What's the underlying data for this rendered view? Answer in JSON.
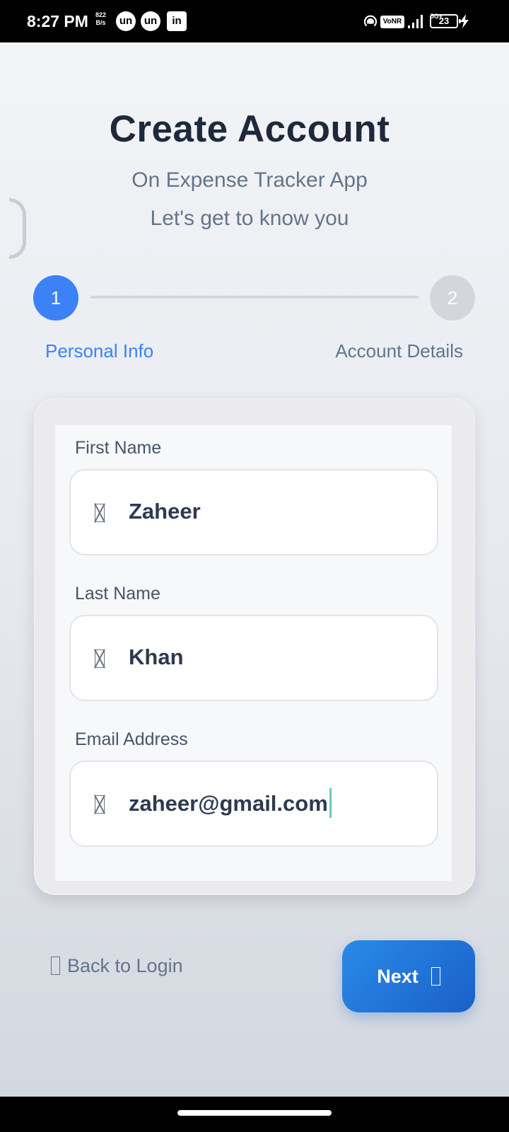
{
  "status_bar": {
    "time": "8:27 PM",
    "speed_value": "822",
    "speed_unit": "B/s",
    "app_icons": [
      "un",
      "un",
      "in"
    ],
    "vonr": "VoNR",
    "network": "5G+",
    "battery": "23"
  },
  "header": {
    "title": "Create Account",
    "subtitle_1": "On Expense Tracker App",
    "subtitle_2": "Let's get to know you"
  },
  "stepper": {
    "steps": [
      {
        "number": "1",
        "label": "Personal Info",
        "active": true
      },
      {
        "number": "2",
        "label": "Account Details",
        "active": false
      }
    ],
    "active_color": "#3b82f6",
    "inactive_color": "#d4d6dd"
  },
  "form": {
    "first_name": {
      "label": "First Name",
      "value": "Zaheer",
      "icon": "user-icon"
    },
    "last_name": {
      "label": "Last Name",
      "value": "Khan",
      "icon": "user-icon"
    },
    "email": {
      "label": "Email Address",
      "value": "zaheer@gmail.com",
      "icon": "email-icon"
    }
  },
  "actions": {
    "back_label": "Back to Login",
    "next_label": "Next",
    "accent_color": "#1f74d8"
  }
}
